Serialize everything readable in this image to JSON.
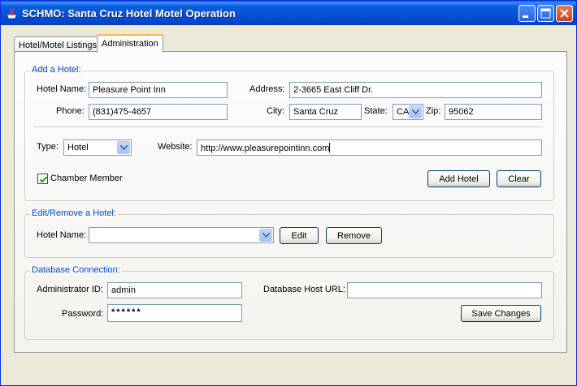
{
  "window": {
    "title": "SCHMO: Santa Cruz Hotel Motel Operation"
  },
  "tabs": [
    {
      "label": "Hotel/Motel Listings"
    },
    {
      "label": "Administration"
    }
  ],
  "add_hotel": {
    "legend": "Add a Hotel:",
    "hotel_name": {
      "label": "Hotel Name:",
      "value": "Pleasure Point Inn"
    },
    "address": {
      "label": "Address:",
      "value": "2-3665 East Cliff Dr."
    },
    "phone": {
      "label": "Phone:",
      "value": "(831)475-4657"
    },
    "city": {
      "label": "City:",
      "value": "Santa Cruz"
    },
    "state": {
      "label": "State:",
      "value": "CA"
    },
    "zip": {
      "label": "Zip:",
      "value": "95062"
    },
    "type": {
      "label": "Type:",
      "value": "Hotel"
    },
    "website": {
      "label": "Website:",
      "value": "http://www.pleasurepointinn.com"
    },
    "chamber": {
      "label": "Chamber Member",
      "checked": true
    },
    "add_button": "Add Hotel",
    "clear_button": "Clear"
  },
  "edit_hotel": {
    "legend": "Edit/Remove a Hotel:",
    "hotel_name": {
      "label": "Hotel Name:",
      "value": ""
    },
    "edit_button": "Edit",
    "remove_button": "Remove"
  },
  "db": {
    "legend": "Database Connection:",
    "admin_id": {
      "label": "Administrator ID:",
      "value": "admin"
    },
    "password": {
      "label": "Password:",
      "value": "******"
    },
    "host_url": {
      "label": "Database Host URL:",
      "value": ""
    },
    "save_button": "Save Changes"
  },
  "colors": {
    "titlebar": "#0a5ede",
    "legend": "#0046d5",
    "tab_accent": "#f7b74a"
  }
}
